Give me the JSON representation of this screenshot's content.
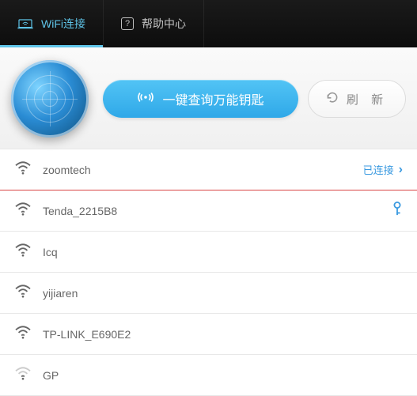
{
  "tabs": {
    "wifi_label": "WiFi连接",
    "help_label": "帮助中心"
  },
  "actions": {
    "scan_label": "一键查询万能钥匙",
    "refresh_label": "刷 新"
  },
  "status": {
    "connected_label": "已连接"
  },
  "networks": [
    {
      "name": "zoomtech",
      "connected": true,
      "has_key": false,
      "signal": 3
    },
    {
      "name": "Tenda_2215B8",
      "connected": false,
      "has_key": true,
      "signal": 3
    },
    {
      "name": "Icq",
      "connected": false,
      "has_key": false,
      "signal": 3
    },
    {
      "name": "yijiaren",
      "connected": false,
      "has_key": false,
      "signal": 3
    },
    {
      "name": "TP-LINK_E690E2",
      "connected": false,
      "has_key": false,
      "signal": 3
    },
    {
      "name": "GP",
      "connected": false,
      "has_key": false,
      "signal": 1
    }
  ],
  "colors": {
    "accent": "#3b9ae0",
    "primary": "#2fa8e8",
    "connected_underline": "#d94444"
  }
}
